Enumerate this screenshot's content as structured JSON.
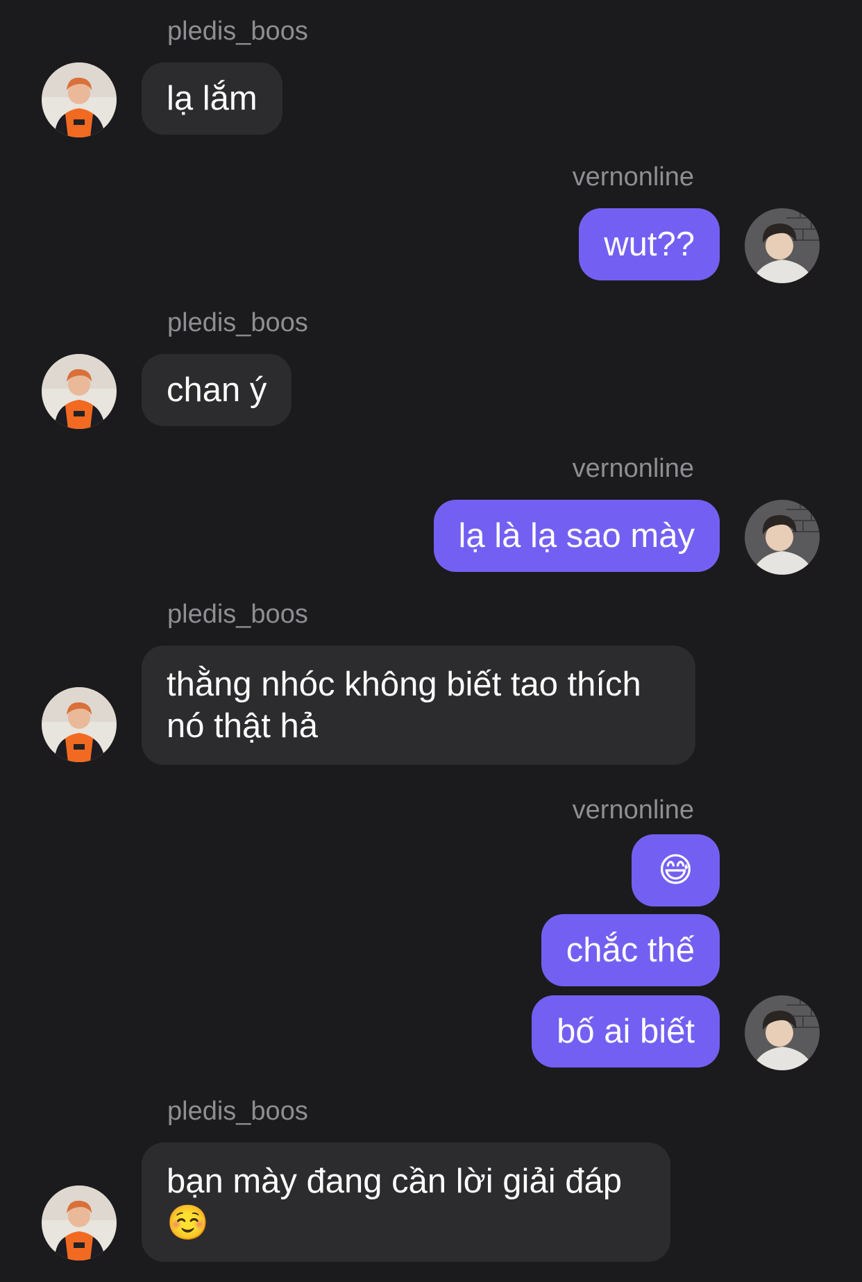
{
  "messages": [
    {
      "sender": "pledis_boos",
      "text": "lạ lắm"
    },
    {
      "sender": "vernonline",
      "text": "wut??"
    },
    {
      "sender": "pledis_boos",
      "text": "chan ý"
    },
    {
      "sender": "vernonline",
      "text": "lạ là lạ sao mày"
    },
    {
      "sender": "pledis_boos",
      "text": "thằng nhóc không biết tao thích nó thật hả"
    },
    {
      "sender": "vernonline",
      "text": "😅"
    },
    {
      "sender": "vernonline",
      "text": "chắc thế"
    },
    {
      "sender": "vernonline",
      "text": "bố ai biết"
    },
    {
      "sender": "pledis_boos",
      "text": "bạn mày đang cần lời giải đáp ☺️"
    }
  ],
  "colors": {
    "background": "#1b1b1d",
    "incoming_bubble": "#2c2c2e",
    "outgoing_bubble": "#7360f2",
    "username": "#8e8e93"
  },
  "icons": {
    "incoming_avatar": "avatar-orange-jersey-icon",
    "outgoing_avatar": "avatar-dark-hair-icon"
  }
}
